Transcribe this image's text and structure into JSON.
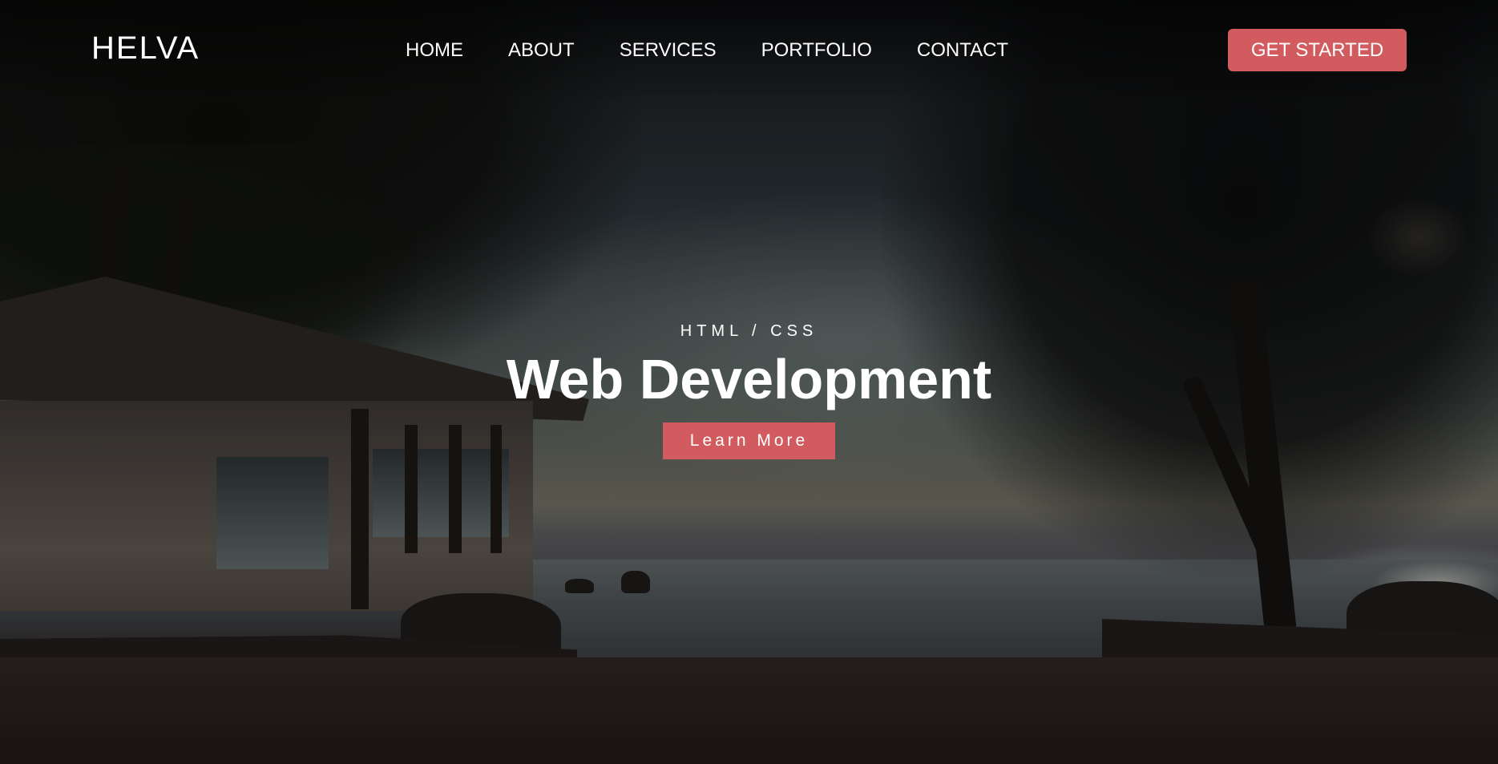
{
  "brand": {
    "logo": "HELVA"
  },
  "nav": {
    "items": [
      {
        "label": "HOME"
      },
      {
        "label": "ABOUT"
      },
      {
        "label": "SERVICES"
      },
      {
        "label": "PORTFOLIO"
      },
      {
        "label": "CONTACT"
      }
    ],
    "cta_label": "GET STARTED"
  },
  "hero": {
    "eyebrow": "HTML / CSS",
    "headline": "Web Development",
    "button_label": "Learn More",
    "background_description": "dusk beach photo with palm trees, hut and sun over the sea"
  },
  "colors": {
    "accent": "#d15b5e",
    "text": "#ffffff"
  }
}
